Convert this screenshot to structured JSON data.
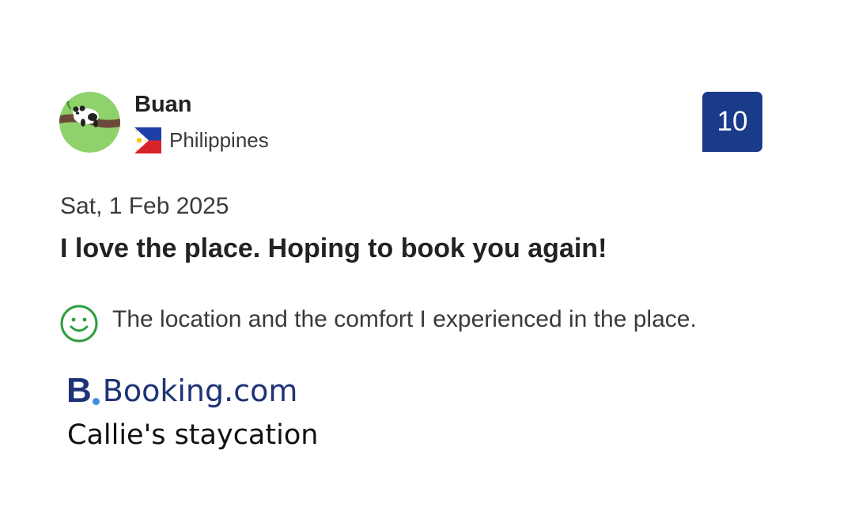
{
  "review": {
    "reviewer": {
      "name": "Buan",
      "country": "Philippines",
      "avatar_icon": "panda-on-branch-avatar",
      "flag_icon": "philippines-flag-icon"
    },
    "score": "10",
    "date": "Sat, 1 Feb 2025",
    "title": "I love the place. Hoping to book you again!",
    "positive": {
      "icon": "smiley-face-icon",
      "text": "The location and the comfort I experienced in the place."
    }
  },
  "brand": {
    "logo_letter": "B",
    "logo_text": "Booking.com",
    "property_name": "Callie's staycation"
  },
  "colors": {
    "score_badge": "#1a3a8a",
    "brand_navy": "#1f3376",
    "brand_dot": "#3d8fe0",
    "positive_green": "#2e9e3e",
    "avatar_bg": "#8fd16a"
  }
}
